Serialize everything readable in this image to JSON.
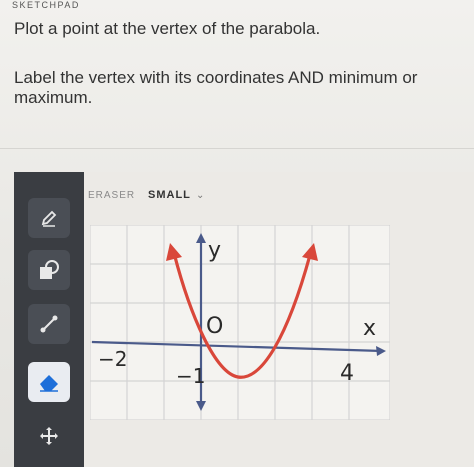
{
  "header": {
    "title": "SKETCHPAD"
  },
  "prompt": {
    "line1": "Plot a point at the vertex of the parabola.",
    "line2": "Label the vertex with its coordinates AND minimum or maximum."
  },
  "toolbar": {
    "items": [
      {
        "name": "pencil",
        "icon": "pencil-icon",
        "active": false
      },
      {
        "name": "shapes",
        "icon": "shapes-icon",
        "active": false
      },
      {
        "name": "line",
        "icon": "line-icon",
        "active": false
      },
      {
        "name": "eraser",
        "icon": "eraser-icon",
        "active": true
      },
      {
        "name": "move",
        "icon": "move-icon",
        "active": false
      }
    ]
  },
  "options": {
    "tool_label": "ERASER",
    "size_value": "SMALL"
  },
  "graph": {
    "y_label": "y",
    "x_label": "x",
    "origin_label": "O",
    "x_neg_label": "−2",
    "x_pos_label": "4",
    "y_neg_label": "−1",
    "curve_color": "#d9473a",
    "axis_color": "#4a5a8a"
  }
}
